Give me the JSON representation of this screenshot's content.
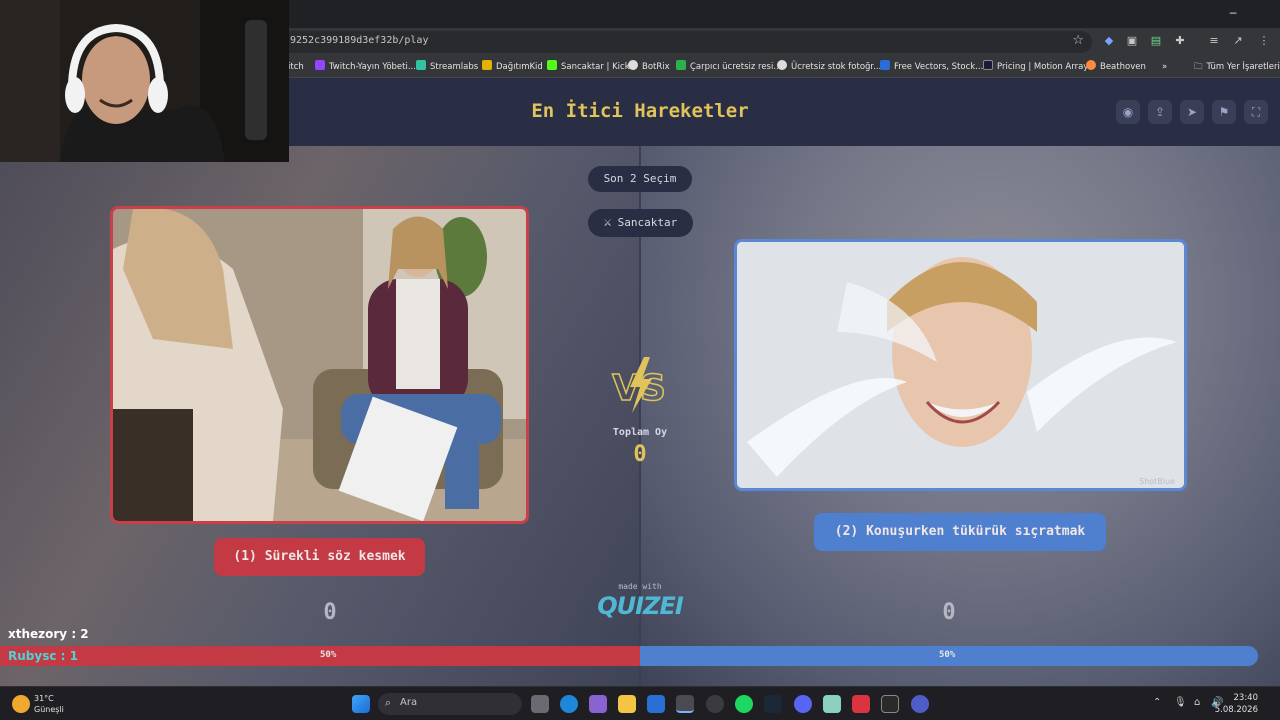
{
  "browser": {
    "url_fragment": "9252c399189d3ef32b/play",
    "window_controls": [
      "─",
      "☐",
      "✕"
    ],
    "bookmarks": [
      {
        "label": "itch",
        "color": "#9146ff"
      },
      {
        "label": "Twitch-Yayın Yöbeti...",
        "color": "#9146ff"
      },
      {
        "label": "Streamlabs",
        "color": "#31c3a2"
      },
      {
        "label": "DağıtımKid",
        "color": "#e5b100"
      },
      {
        "label": "Sancaktar | Kick",
        "color": "#53fc18"
      },
      {
        "label": "BotRix",
        "color": "#dddddd"
      },
      {
        "label": "Çarpıcı ücretsiz resi...",
        "color": "#2bb24c"
      },
      {
        "label": "Ücretsiz stok fotoğr...",
        "color": "#dddddd"
      },
      {
        "label": "Free Vectors, Stock...",
        "color": "#2a6dd9"
      },
      {
        "label": "Pricing | Motion Array",
        "color": "#1a1a3a"
      },
      {
        "label": "Beathoven",
        "color": "#ff8a3d"
      },
      {
        "label": "»",
        "color": ""
      },
      {
        "label": "Tüm Yer İşaretleri",
        "color": ""
      }
    ]
  },
  "page": {
    "title": "En İtici Hareketler",
    "pill_round": "Son 2 Seçim",
    "pill_author": "Sancaktar",
    "total_label": "Toplam Oy",
    "total_value": "0",
    "made_with": "made with",
    "brand": "QUIZEI",
    "vs_text": "VS",
    "options": [
      {
        "label": "(1) Sürekli söz kesmek",
        "score": "0",
        "percent": "50%",
        "color": "#c33a44"
      },
      {
        "label": "(2) Konuşurken tükürük sıçratmak",
        "score": "0",
        "percent": "50%",
        "color": "#4f7fcf"
      }
    ],
    "watermark": "ShotBlue"
  },
  "chat": [
    {
      "user": "xthezory",
      "count": "2",
      "color": "#ffffff"
    },
    {
      "user": "Rubysc",
      "count": "1",
      "color": "#4fd2d6"
    }
  ],
  "taskbar": {
    "weather_temp": "31°C",
    "weather_desc": "Güneşli",
    "search_placeholder": "Ara",
    "time": "23:40",
    "date": "5.08.2026"
  }
}
